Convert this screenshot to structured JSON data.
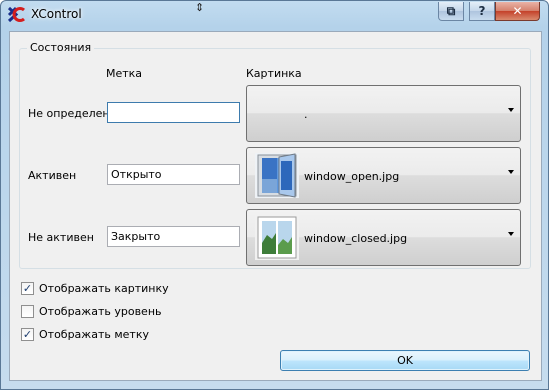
{
  "window": {
    "title": "XControl",
    "app_icon_letter": "X",
    "title_buttons": {
      "restore": "⧉",
      "help": "?",
      "close": "✕"
    }
  },
  "group": {
    "title": "Состояния",
    "headers": {
      "label": "Метка",
      "picture": "Картинка"
    },
    "rows": [
      {
        "state": "Не определен",
        "label_value": "",
        "picture": "."
      },
      {
        "state": "Активен",
        "label_value": "Открыто",
        "picture": "window_open.jpg"
      },
      {
        "state": "Не активен",
        "label_value": "Закрыто",
        "picture": "window_closed.jpg"
      }
    ]
  },
  "options": [
    {
      "label": "Отображать картинку",
      "checked": true
    },
    {
      "label": "Отображать уровень",
      "checked": false
    },
    {
      "label": "Отображать метку",
      "checked": true
    }
  ],
  "ok_label": "OK",
  "colors": {
    "accent": "#3c7fb1",
    "titlebar": "#b4d2ea",
    "close": "#c4412a"
  }
}
